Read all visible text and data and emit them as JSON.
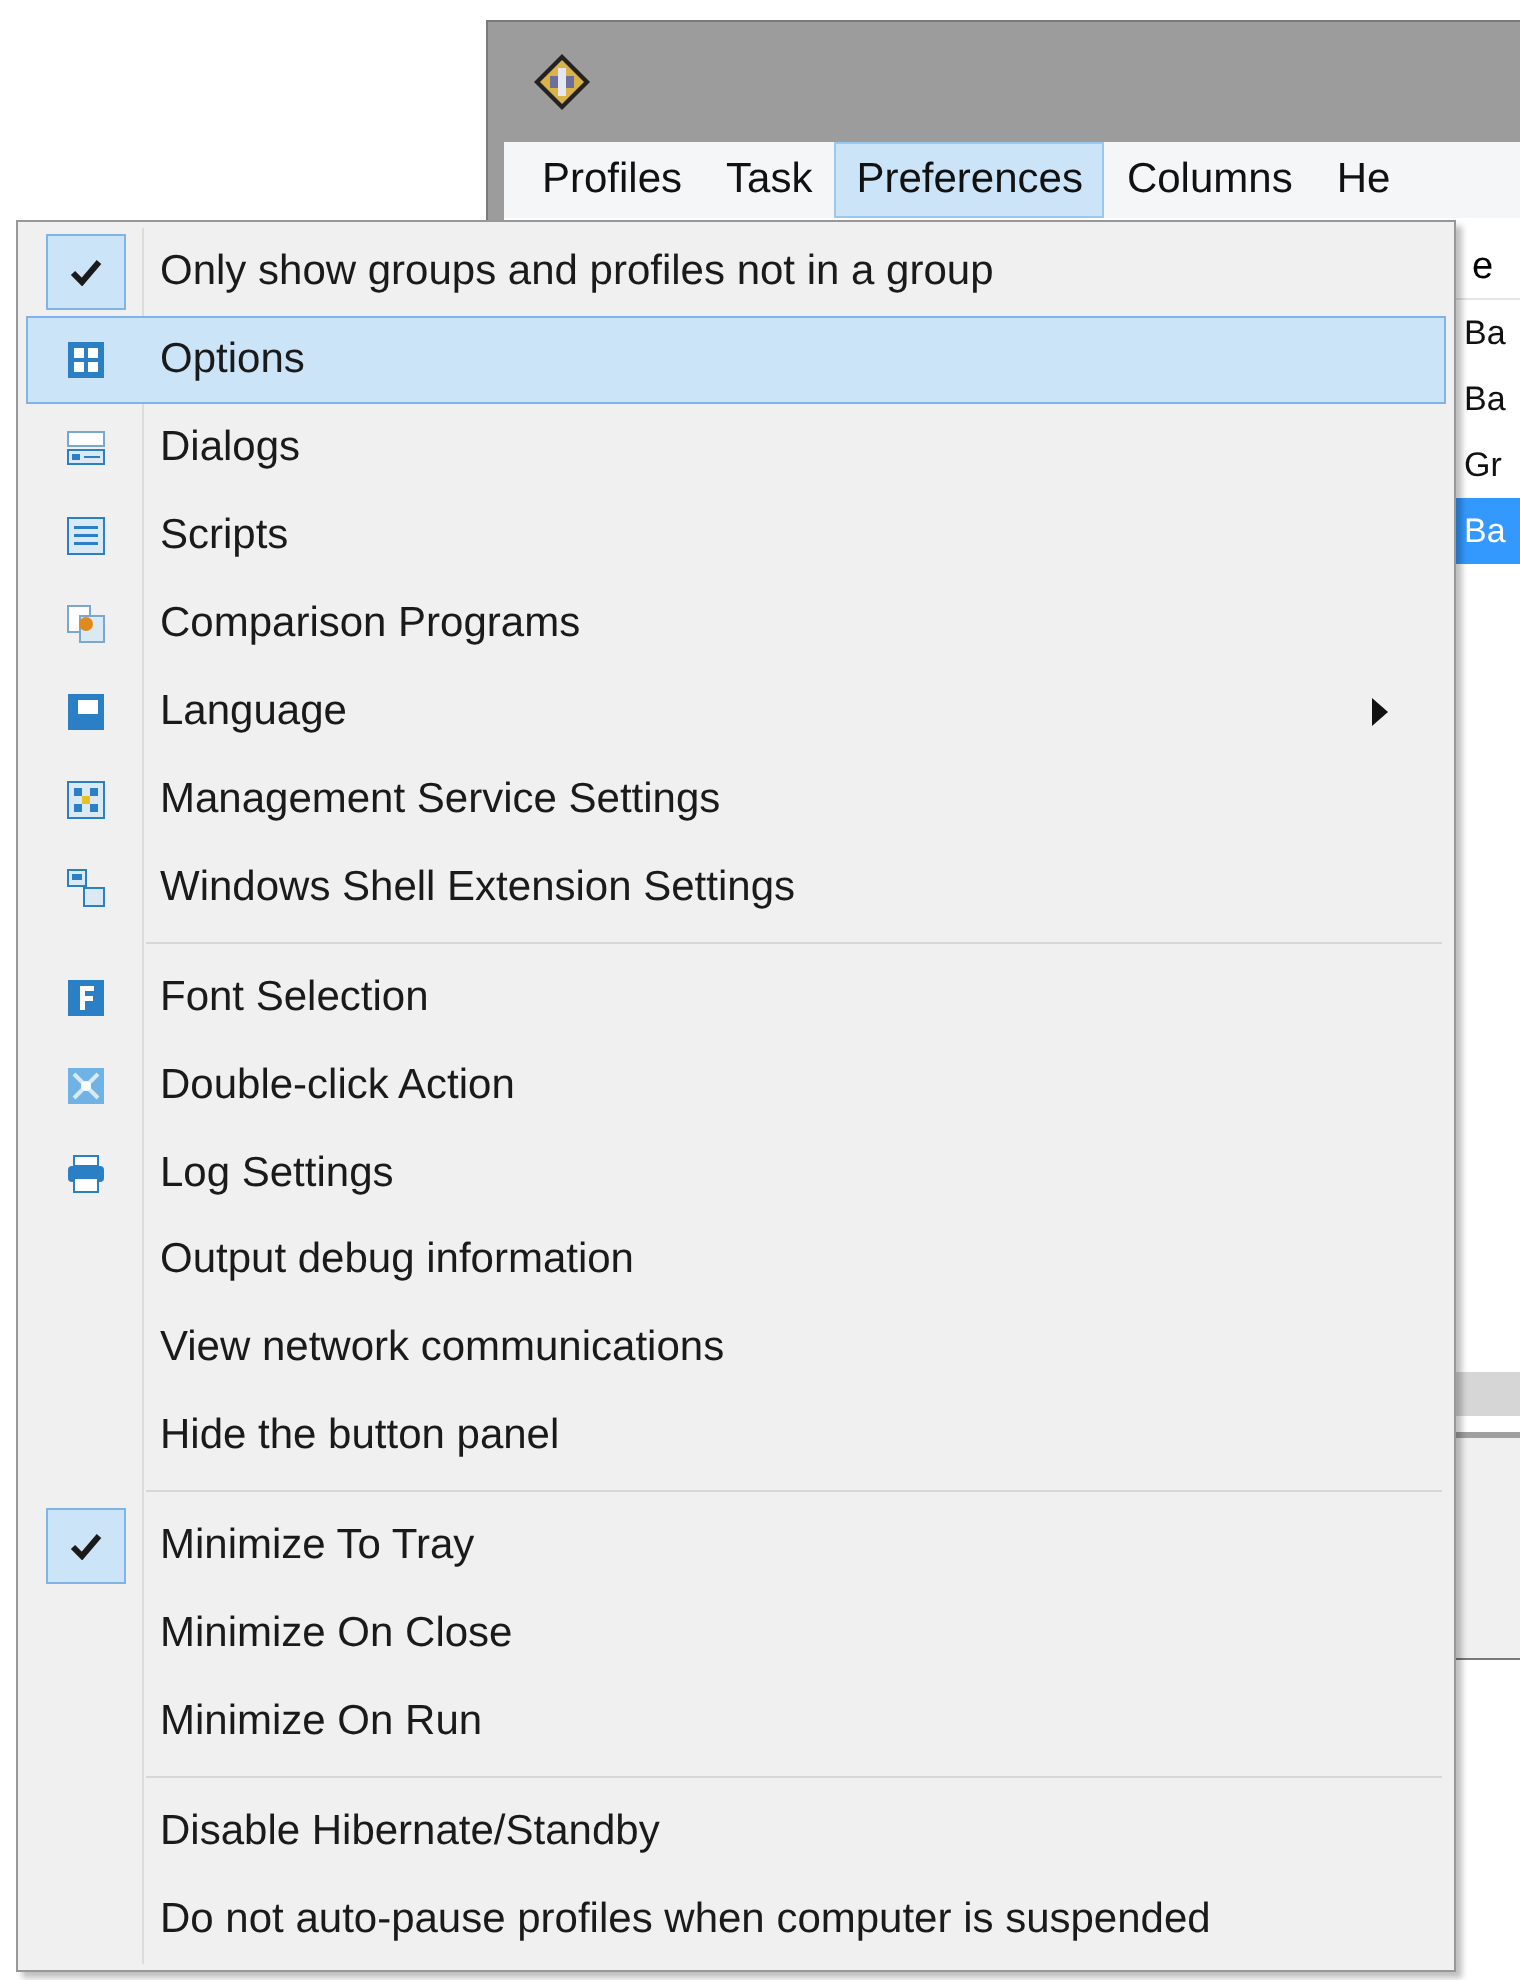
{
  "window": {
    "menu_bar": [
      {
        "label": "Profiles",
        "selected": false
      },
      {
        "label": "Task",
        "selected": false
      },
      {
        "label": "Preferences",
        "selected": true
      },
      {
        "label": "Columns",
        "selected": false
      },
      {
        "label": "He",
        "selected": false
      }
    ],
    "list": {
      "column_1": "e",
      "rows": [
        {
          "text": "Ba",
          "selected": false
        },
        {
          "text": "Ba",
          "selected": false
        },
        {
          "text": "Gr",
          "selected": false
        },
        {
          "text": "Ba",
          "selected": true
        }
      ]
    }
  },
  "menu": {
    "sections": [
      {
        "items": [
          {
            "label": "Only show groups and profiles not in a group",
            "kind": "check",
            "checked": true,
            "selected": false
          },
          {
            "label": "Options",
            "kind": "icon",
            "selected": true
          },
          {
            "label": "Dialogs",
            "kind": "icon",
            "selected": false
          },
          {
            "label": "Scripts",
            "kind": "icon",
            "selected": false
          },
          {
            "label": "Comparison Programs",
            "kind": "icon",
            "selected": false
          },
          {
            "label": "Language",
            "kind": "icon",
            "selected": false,
            "submenu": true
          },
          {
            "label": "Management Service Settings",
            "kind": "icon",
            "selected": false
          },
          {
            "label": "Windows Shell Extension Settings",
            "kind": "icon",
            "selected": false
          }
        ]
      },
      {
        "items": [
          {
            "label": "Font Selection",
            "kind": "icon",
            "selected": false
          },
          {
            "label": "Double-click Action",
            "kind": "icon",
            "selected": false
          },
          {
            "label": "Log Settings",
            "kind": "icon",
            "selected": false
          },
          {
            "label": "Output debug information",
            "kind": "plain",
            "selected": false
          },
          {
            "label": "View network communications",
            "kind": "plain",
            "selected": false
          },
          {
            "label": "Hide the button panel",
            "kind": "plain",
            "selected": false
          }
        ]
      },
      {
        "items": [
          {
            "label": "Minimize To Tray",
            "kind": "check",
            "checked": true,
            "selected": false
          },
          {
            "label": "Minimize On Close",
            "kind": "check",
            "checked": false,
            "selected": false
          },
          {
            "label": "Minimize On Run",
            "kind": "check",
            "checked": false,
            "selected": false
          }
        ]
      },
      {
        "items": [
          {
            "label": "Disable Hibernate/Standby",
            "kind": "check",
            "checked": false,
            "selected": false
          },
          {
            "label": "Do not auto-pause profiles when computer is suspended",
            "kind": "check",
            "checked": false,
            "selected": false
          }
        ]
      }
    ]
  }
}
